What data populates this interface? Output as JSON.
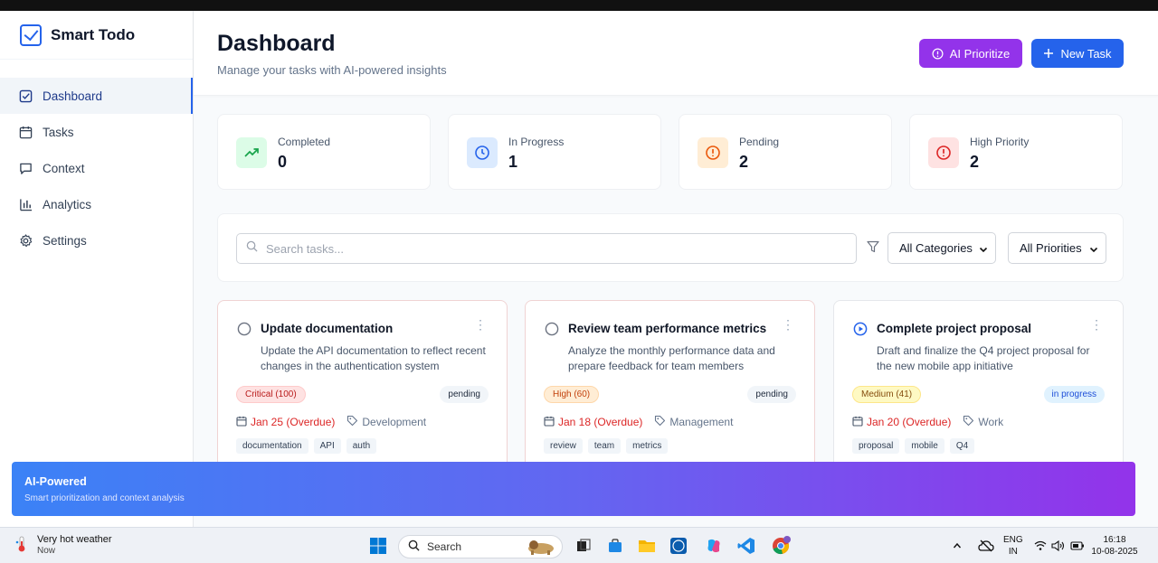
{
  "app": {
    "name": "Smart Todo"
  },
  "sidebar": {
    "items": [
      {
        "label": "Dashboard",
        "icon": "checkbox-icon",
        "active": true
      },
      {
        "label": "Tasks",
        "icon": "calendar-icon"
      },
      {
        "label": "Context",
        "icon": "message-icon"
      },
      {
        "label": "Analytics",
        "icon": "bar-chart-icon"
      },
      {
        "label": "Settings",
        "icon": "gear-icon"
      }
    ]
  },
  "header": {
    "title": "Dashboard",
    "subtitle": "Manage your tasks with AI-powered insights",
    "ai_button": "AI Prioritize",
    "new_button": "New Task"
  },
  "stats": [
    {
      "label": "Completed",
      "value": "0",
      "color": "#16a34a"
    },
    {
      "label": "In Progress",
      "value": "1",
      "color": "#2563eb"
    },
    {
      "label": "Pending",
      "value": "2",
      "color": "#ea580c"
    },
    {
      "label": "High Priority",
      "value": "2",
      "color": "#dc2626"
    }
  ],
  "filters": {
    "search_placeholder": "Search tasks...",
    "category": "All Categories",
    "priority": "All Priorities"
  },
  "tasks": [
    {
      "title": "Update documentation",
      "description": "Update the API documentation to reflect recent changes in the authentication system",
      "priority": "Critical (100)",
      "status": "pending",
      "due": "Jan 25 (Overdue)",
      "category": "Development",
      "tags": [
        "documentation",
        "API",
        "auth"
      ]
    },
    {
      "title": "Review team performance metrics",
      "description": "Analyze the monthly performance data and prepare feedback for team members",
      "priority": "High (60)",
      "status": "pending",
      "due": "Jan 18 (Overdue)",
      "category": "Management",
      "tags": [
        "review",
        "team",
        "metrics"
      ]
    },
    {
      "title": "Complete project proposal",
      "description": "Draft and finalize the Q4 project proposal for the new mobile app initiative",
      "priority": "Medium (41)",
      "status": "in progress",
      "due": "Jan 20 (Overdue)",
      "category": "Work",
      "tags": [
        "proposal",
        "mobile",
        "Q4"
      ]
    }
  ],
  "banner": {
    "title": "AI-Powered",
    "subtitle": "Smart prioritization and context analysis"
  },
  "taskbar": {
    "weather_title": "Very hot weather",
    "weather_sub": "Now",
    "search": "Search",
    "lang_top": "ENG",
    "lang_bottom": "IN",
    "time": "16:18",
    "date": "10-08-2025"
  }
}
